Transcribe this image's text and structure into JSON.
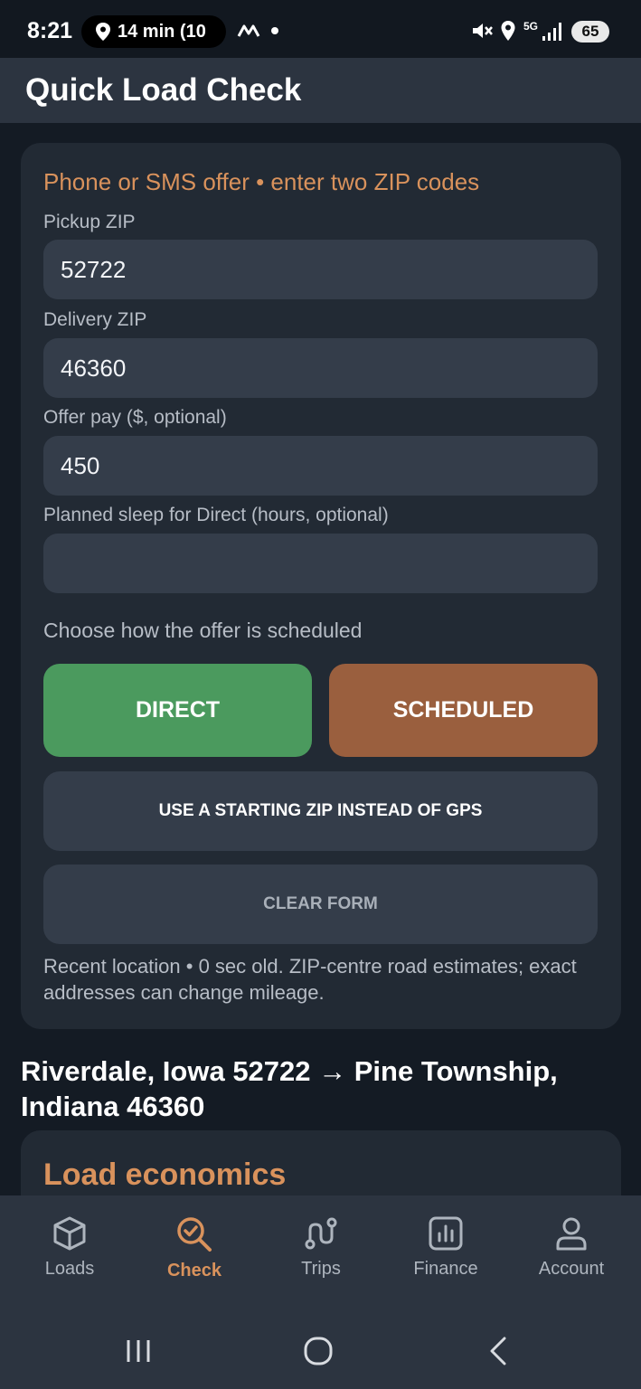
{
  "status_bar": {
    "time": "8:21",
    "navigation_pill": "14 min (10",
    "battery": "65",
    "network": "5G"
  },
  "app_bar": {
    "title": "Quick Load Check"
  },
  "form": {
    "heading": "Phone or SMS offer • enter two ZIP codes",
    "pickup": {
      "label": "Pickup ZIP",
      "value": "52722"
    },
    "delivery": {
      "label": "Delivery ZIP",
      "value": "46360"
    },
    "offer_pay": {
      "label": "Offer pay ($, optional)",
      "value": "450"
    },
    "planned_sleep": {
      "label": "Planned sleep for Direct (hours, optional)",
      "value": ""
    },
    "schedule_prompt": "Choose how the offer is scheduled",
    "direct_label": "DIRECT",
    "scheduled_label": "SCHEDULED",
    "starting_zip_label": "USE A STARTING ZIP INSTEAD OF GPS",
    "clear_label": "CLEAR FORM",
    "note": "Recent location • 0 sec old. ZIP-centre road estimates; exact addresses can change mileage."
  },
  "route": {
    "title": "Riverdale, Iowa 52722 → Pine Township, Indiana 46360"
  },
  "economics": {
    "title": "Load economics"
  },
  "bottom_nav": {
    "items": [
      {
        "label": "Loads",
        "icon": "cube-icon",
        "active": false
      },
      {
        "label": "Check",
        "icon": "check-search-icon",
        "active": true
      },
      {
        "label": "Trips",
        "icon": "route-icon",
        "active": false
      },
      {
        "label": "Finance",
        "icon": "bar-chart-icon",
        "active": false
      },
      {
        "label": "Account",
        "icon": "person-icon",
        "active": false
      }
    ]
  },
  "colors": {
    "accent": "#d9925c",
    "direct": "#4b9a5e",
    "scheduled": "#9a5f3e",
    "card": "#222a34",
    "field": "#343d4a"
  }
}
